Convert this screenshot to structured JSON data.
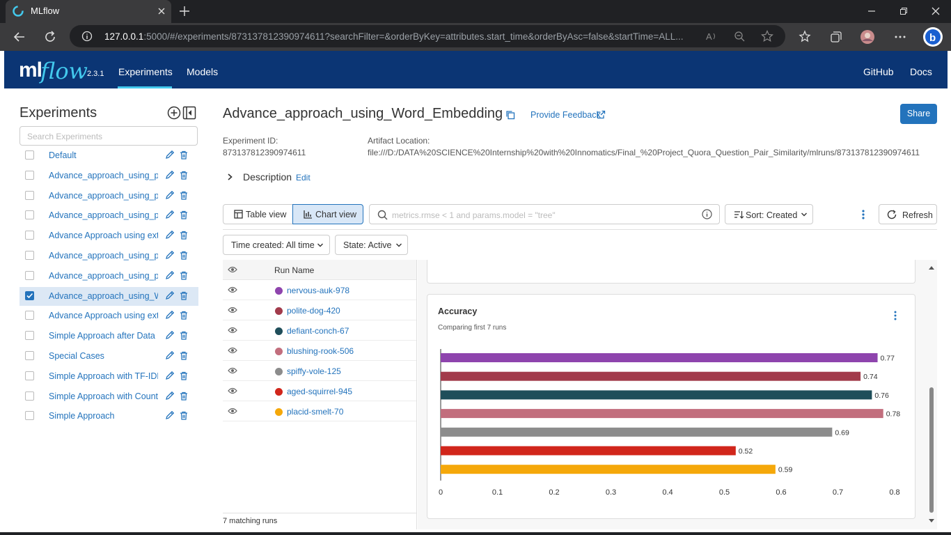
{
  "browser": {
    "tab_title": "MLflow",
    "url_host": "127.0.0.1",
    "url_rest": ":5000/#/experiments/873137812390974611?searchFilter=&orderByKey=attributes.start_time&orderByAsc=false&startTime=ALL..."
  },
  "header": {
    "logo_ml": "ml",
    "logo_flow": "flow",
    "version": "2.3.1",
    "nav_experiments": "Experiments",
    "nav_models": "Models",
    "nav_github": "GitHub",
    "nav_docs": "Docs"
  },
  "sidebar": {
    "title": "Experiments",
    "search_placeholder": "Search Experiments",
    "experiments": [
      {
        "name": "Default",
        "selected": false
      },
      {
        "name": "Advance_approach_using_pr...",
        "selected": false
      },
      {
        "name": "Advance_approach_using_pr...",
        "selected": false
      },
      {
        "name": "Advance_approach_using_pr...",
        "selected": false
      },
      {
        "name": "Advance Approach using ext...",
        "selected": false
      },
      {
        "name": "Advance_approach_using_pr...",
        "selected": false
      },
      {
        "name": "Advance_approach_using_pr...",
        "selected": false
      },
      {
        "name": "Advance_approach_using_W...",
        "selected": true
      },
      {
        "name": "Advance Approach using ext...",
        "selected": false
      },
      {
        "name": "Simple Approach after Data ...",
        "selected": false
      },
      {
        "name": "Special Cases",
        "selected": false
      },
      {
        "name": "Simple Approach with TF-IDF",
        "selected": false
      },
      {
        "name": "Simple Approach with Count...",
        "selected": false
      },
      {
        "name": "Simple Approach",
        "selected": false
      }
    ]
  },
  "experiment": {
    "title": "Advance_approach_using_Word_Embedding",
    "feedback_label": "Provide Feedback",
    "share_label": "Share",
    "id_label": "Experiment ID:",
    "id_value": "873137812390974611",
    "artifact_label": "Artifact Location:",
    "artifact_value": "file:///D:/DATA%20SCIENCE%20Internship%20with%20Innomatics/Final_%20Project_Quora_Question_Pair_Similarity/mlruns/873137812390974611",
    "description_label": "Description",
    "description_edit": "Edit"
  },
  "toolbar": {
    "table_view": "Table view",
    "chart_view": "Chart view",
    "search_placeholder": "metrics.rmse < 1 and params.model = \"tree\"",
    "sort_label": "Sort: Created",
    "refresh_label": "Refresh",
    "time_filter": "Time created: All time",
    "state_filter": "State: Active"
  },
  "runs": {
    "header": "Run Name",
    "rows": [
      {
        "name": "nervous-auk-978",
        "color": "#8e44ad"
      },
      {
        "name": "polite-dog-420",
        "color": "#a23b4b"
      },
      {
        "name": "defiant-conch-67",
        "color": "#1f4e5a"
      },
      {
        "name": "blushing-rook-506",
        "color": "#c26e7d"
      },
      {
        "name": "spiffy-vole-125",
        "color": "#8c8c8c"
      },
      {
        "name": "aged-squirrel-945",
        "color": "#d1261b"
      },
      {
        "name": "placid-smelt-70",
        "color": "#f5a80a"
      }
    ],
    "footer": "7 matching runs"
  },
  "chart_data": {
    "type": "bar",
    "orientation": "horizontal",
    "title": "Accuracy",
    "subtitle": "Comparing first 7 runs",
    "categories": [
      "nervous-auk-978",
      "polite-dog-420",
      "defiant-conch-67",
      "blushing-rook-506",
      "spiffy-vole-125",
      "aged-squirrel-945",
      "placid-smelt-70"
    ],
    "values": [
      0.77,
      0.74,
      0.76,
      0.78,
      0.69,
      0.52,
      0.59
    ],
    "value_labels": [
      "0.77",
      "0.74",
      "0.76",
      "0.78",
      "0.69",
      "0.52",
      "0.59"
    ],
    "colors": [
      "#8e44ad",
      "#a23b4b",
      "#1f4e5a",
      "#c26e7d",
      "#8c8c8c",
      "#d1261b",
      "#f5a80a"
    ],
    "xlim": [
      0,
      0.8
    ],
    "x_ticks": [
      "0",
      "0.1",
      "0.2",
      "0.3",
      "0.4",
      "0.5",
      "0.6",
      "0.7",
      "0.8"
    ],
    "xlabel": "",
    "ylabel": "",
    "grid": false
  },
  "colors": {
    "header_bg": "#0b3574",
    "accent": "#2373bc",
    "logo_accent": "#43c9ed"
  }
}
